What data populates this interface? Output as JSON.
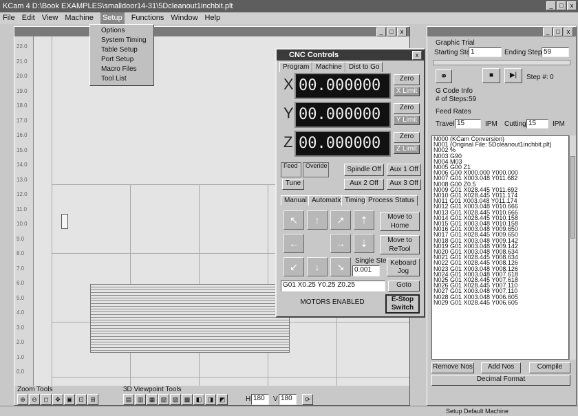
{
  "app": {
    "title": "KCam 4  D:\\Book EXAMPLES\\smalldoor14-31\\5Dcleanout1inchbit.plt",
    "min_label": "_",
    "max_label": "□",
    "close_label": "x"
  },
  "menu": {
    "items": [
      "File",
      "Edit",
      "View",
      "Machine",
      "Setup",
      "Functions",
      "Window",
      "Help"
    ],
    "active": "Setup",
    "dropdown": [
      "Options",
      "System Timing",
      "Table Setup",
      "Port Setup",
      "Macro Files",
      "Tool List"
    ]
  },
  "ruler": {
    "labels": [
      "22.0",
      "21.0",
      "20.0",
      "19.0",
      "18.0",
      "17.0",
      "16.0",
      "15.0",
      "14.0",
      "13.0",
      "12.0",
      "11.0",
      "10.0",
      "9.0",
      "8.0",
      "7.0",
      "6.0",
      "5.0",
      "4.0",
      "3.0",
      "2.0",
      "1.0",
      "0.0"
    ]
  },
  "bottom_toolbar": {
    "zoom_label": "Zoom Tools",
    "views_label": "3D Viewpoint Tools",
    "h_value": "180",
    "v_value": "180",
    "h_prefix": "H",
    "v_prefix": "V"
  },
  "cnc": {
    "title": "CNC Controls",
    "tabs": [
      "Program",
      "Machine",
      "Dist to Go"
    ],
    "axes": [
      {
        "axis": "X",
        "value": "00.000000",
        "zero": "Zero",
        "limit": "X Limit"
      },
      {
        "axis": "Y",
        "value": "00.000000",
        "zero": "Zero",
        "limit": "Y Limit"
      },
      {
        "axis": "Z",
        "value": "00.000000",
        "zero": "Zero",
        "limit": "Z Limit"
      }
    ],
    "feed_label": "Feed",
    "overide_label": "Overide",
    "spindle_off": "Spindle Off",
    "aux1_off": "Aux 1 Off",
    "aux2_off": "Aux 2 Off",
    "aux3_off": "Aux 3 Off",
    "tune": "Tune",
    "subtabs": [
      "Manual",
      "Automatic",
      "Timing",
      "Process Status"
    ],
    "move_home": "Move to Home",
    "move_retool": "Move to ReTool",
    "single_step": "Single Step",
    "step_value": "0.001",
    "keyboard_jog": "Keboard Jog",
    "command": "G01 X0.25 Y0.25 Z0.25",
    "goto": "Goto",
    "status": "MOTORS ENABLED",
    "estop": "E-Stop Switch"
  },
  "right_panel": {
    "graphic_trial": "Graphic Trial",
    "starting_step_label": "Starting Step",
    "starting_step": "1",
    "ending_step_label": "Ending Step",
    "ending_step": "59",
    "step_label": "Step #:",
    "step_value": "0",
    "gcode_info": "G Code Info",
    "steps_label": "# of Steps:",
    "steps_value": "59",
    "feed_rates": "Feed Rates",
    "travel_label": "Travel",
    "travel_value": "15",
    "ipm1": "IPM",
    "cutting_label": "Cutting",
    "cutting_value": "15",
    "ipm2": "IPM",
    "gcode": [
      "N000 (KCam Conversion)",
      "N001 (Original File: 5Dcleanout1inchbit.plt)",
      "N002 %",
      "N003 G90",
      "N004 M03",
      "N005 G00 Z1",
      "N006 G00 X000.000 Y000.000",
      "N007 G01 X003.048 Y011.682",
      "N008 G00 Z0.5",
      "N009 G01 X028.445 Y011.692",
      "N010 G01 X028.445 Y011.174",
      "N011 G01 X003.048 Y011.174",
      "N012 G01 X003.048 Y010.666",
      "N013 G01 X028.445 Y010.666",
      "N014 G01 X028.445 Y010.158",
      "N015 G01 X003.048 Y010.158",
      "N016 G01 X003.048 Y009.650",
      "N017 G01 X028.445 Y009.650",
      "N018 G01 X003.048 Y009.142",
      "N019 G01 X003.048 Y009.142",
      "N020 G01 X003.048 Y008.634",
      "N021 G01 X028.445 Y008.634",
      "N022 G01 X028.445 Y008.126",
      "N023 G01 X003.048 Y008.126",
      "N024 G01 X003.048 Y007.618",
      "N025 G01 X028.445 Y007.618",
      "N026 G01 X028.445 Y007.110",
      "N027 G01 X003.048 Y007.110",
      "N028 G01 X003.048 Y006.605",
      "N029 G01 X028.445 Y006.605"
    ],
    "remove_nos": "Remove Nos",
    "add_nos": "Add Nos",
    "compile": "Compile",
    "format": "Decimal Format"
  },
  "statusbar": {
    "text": "Setup Default Machine"
  }
}
